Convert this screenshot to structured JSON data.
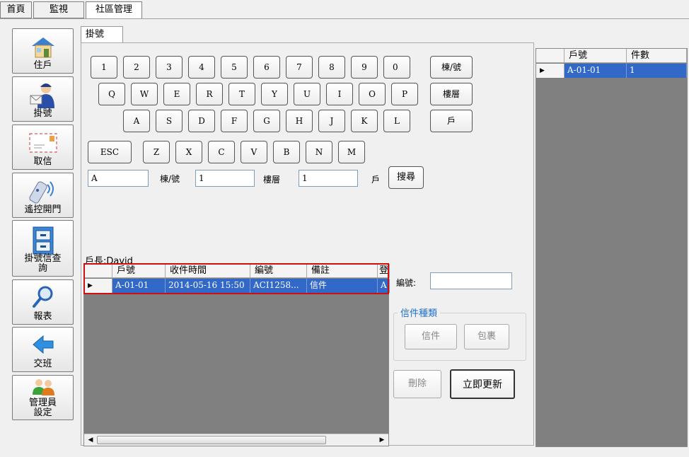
{
  "top_tabs": [
    "首頁",
    "監視",
    "社區管理"
  ],
  "sidebar": {
    "items": [
      {
        "label": "住戶",
        "icon": "house-icon"
      },
      {
        "label": "掛號",
        "icon": "mailman-icon"
      },
      {
        "label": "取信",
        "icon": "envelope-icon"
      },
      {
        "label": "遙控開門",
        "icon": "remote-control-icon"
      },
      {
        "label": "掛號信查詢",
        "icon": "file-cabinet-icon"
      },
      {
        "label": "報表",
        "icon": "magnifier-icon"
      },
      {
        "label": "交班",
        "icon": "back-arrow-icon"
      },
      {
        "label": "管理員設定",
        "icon": "admins-icon"
      }
    ]
  },
  "panel_tab": "掛號",
  "keyboard": {
    "row1": [
      "1",
      "2",
      "3",
      "4",
      "5",
      "6",
      "7",
      "8",
      "9",
      "0"
    ],
    "row2": [
      "Q",
      "W",
      "E",
      "R",
      "T",
      "Y",
      "U",
      "I",
      "O",
      "P"
    ],
    "row3": [
      "A",
      "S",
      "D",
      "F",
      "G",
      "H",
      "J",
      "K",
      "L"
    ],
    "row4": [
      "ESC",
      "Z",
      "X",
      "C",
      "V",
      "B",
      "N",
      "M"
    ],
    "fields": [
      "棟/號",
      "樓層",
      "戶"
    ]
  },
  "search": {
    "building_value": "A",
    "building_label": "棟/號",
    "floor_value": "1",
    "floor_label": "樓層",
    "unit_value": "1",
    "unit_label": "戶",
    "search_button": "搜尋"
  },
  "owner_label": "戶長:David",
  "mail_table": {
    "columns": [
      "戶號",
      "收件時間",
      "編號",
      "備註",
      "登"
    ],
    "rows": [
      {
        "unit": "A-01-01",
        "time": "2014-05-16 15:50",
        "code": "ACI1258...",
        "note": "信件",
        "extra": "A"
      }
    ]
  },
  "number_label": "編號:",
  "number_value": "",
  "mail_type": {
    "title": "信件種類",
    "letter": "信件",
    "parcel": "包裹"
  },
  "delete_button": "刪除",
  "update_button": "立即更新",
  "right_table": {
    "columns": [
      "戶號",
      "件數"
    ],
    "rows": [
      {
        "unit": "A-01-01",
        "count": "1"
      }
    ]
  },
  "colors": {
    "selection": "#3268c8",
    "highlight_border": "#d01010",
    "group_title": "#1e6fd0"
  }
}
